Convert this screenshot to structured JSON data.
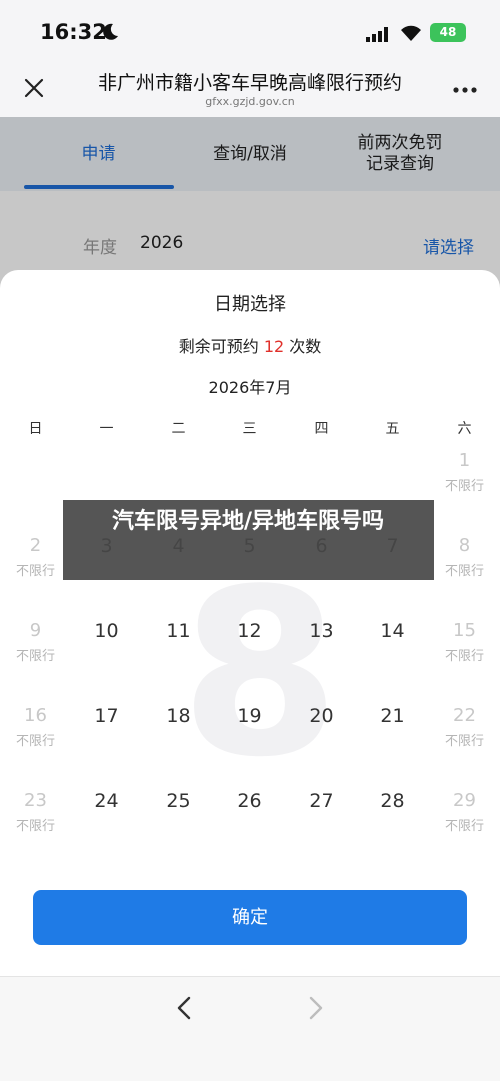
{
  "status_bar": {
    "time": "16:32",
    "battery": "48"
  },
  "nav": {
    "title": "非广州市籍小客车早晚高峰限行预约",
    "url": "gfxx.gzjd.gov.cn"
  },
  "tabs": [
    {
      "label": "申请"
    },
    {
      "label": "查询/取消"
    },
    {
      "label": "前两次免罚\n记录查询"
    }
  ],
  "year_row": {
    "label": "年度",
    "value": "2026",
    "action": "请选择"
  },
  "sheet": {
    "title": "日期选择",
    "remaining_prefix": "剩余可预约",
    "remaining_count": "12",
    "remaining_suffix": "次数",
    "month": "2026年7月",
    "weekdays": [
      "日",
      "一",
      "二",
      "三",
      "四",
      "五",
      "六"
    ],
    "watermark_month": "8",
    "rows": [
      [
        {
          "d": "",
          "s": ""
        },
        {
          "d": "",
          "s": ""
        },
        {
          "d": "",
          "s": ""
        },
        {
          "d": "",
          "s": ""
        },
        {
          "d": "",
          "s": ""
        },
        {
          "d": "",
          "s": ""
        },
        {
          "d": "1",
          "s": "不限行",
          "m": true
        }
      ],
      [
        {
          "d": "2",
          "s": "不限行",
          "m": true
        },
        {
          "d": "3",
          "s": ""
        },
        {
          "d": "4",
          "s": ""
        },
        {
          "d": "5",
          "s": ""
        },
        {
          "d": "6",
          "s": ""
        },
        {
          "d": "7",
          "s": ""
        },
        {
          "d": "8",
          "s": "不限行",
          "m": true
        }
      ],
      [
        {
          "d": "9",
          "s": "不限行",
          "m": true
        },
        {
          "d": "10",
          "s": ""
        },
        {
          "d": "11",
          "s": ""
        },
        {
          "d": "12",
          "s": ""
        },
        {
          "d": "13",
          "s": ""
        },
        {
          "d": "14",
          "s": ""
        },
        {
          "d": "15",
          "s": "不限行",
          "m": true
        }
      ],
      [
        {
          "d": "16",
          "s": "不限行",
          "m": true
        },
        {
          "d": "17",
          "s": ""
        },
        {
          "d": "18",
          "s": ""
        },
        {
          "d": "19",
          "s": ""
        },
        {
          "d": "20",
          "s": ""
        },
        {
          "d": "21",
          "s": ""
        },
        {
          "d": "22",
          "s": "不限行",
          "m": true
        }
      ],
      [
        {
          "d": "23",
          "s": "不限行",
          "m": true
        },
        {
          "d": "24",
          "s": ""
        },
        {
          "d": "25",
          "s": ""
        },
        {
          "d": "26",
          "s": ""
        },
        {
          "d": "27",
          "s": ""
        },
        {
          "d": "28",
          "s": ""
        },
        {
          "d": "29",
          "s": "不限行",
          "m": true
        }
      ]
    ],
    "confirm": "确定"
  },
  "banner": {
    "text": "汽车限号异地/异地车限号吗"
  },
  "colors": {
    "accent": "#1f6fd8",
    "button": "#1f7be6",
    "highlight": "#e0302a",
    "battery": "#3cc35b"
  }
}
